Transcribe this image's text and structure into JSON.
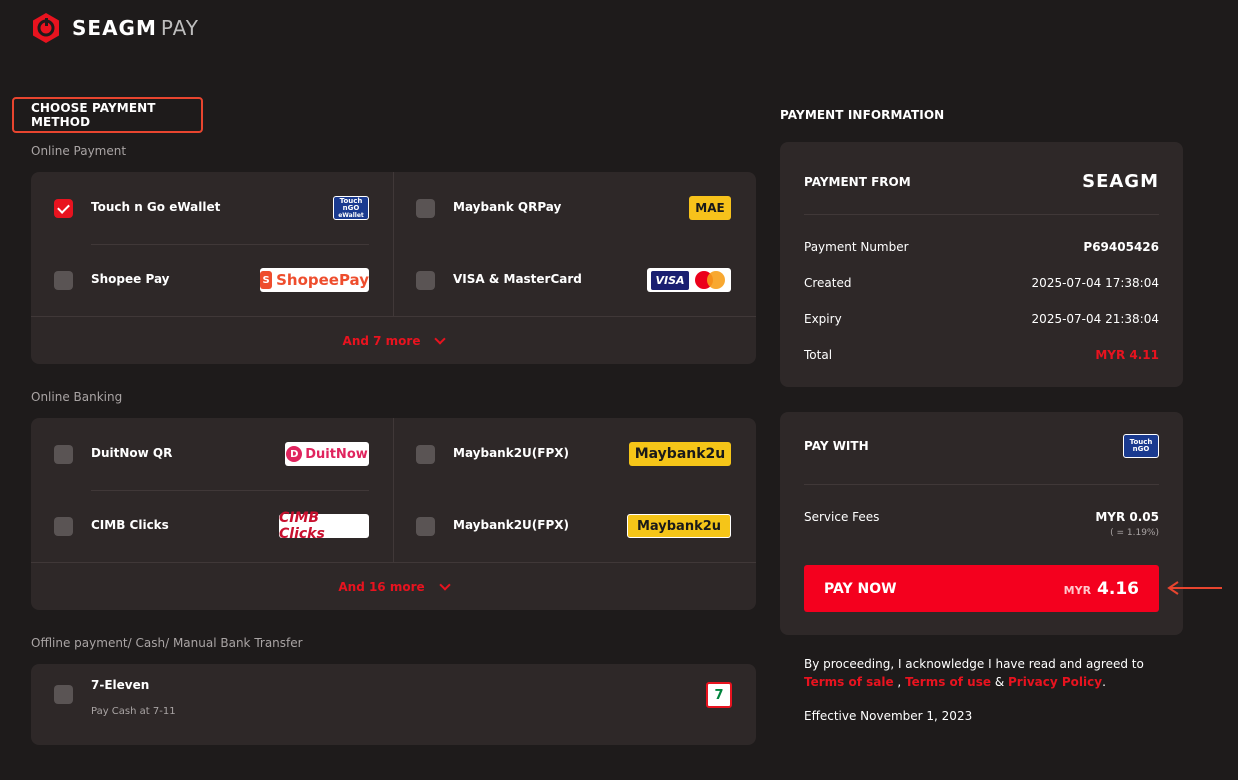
{
  "brand": {
    "name": "SEAGM",
    "suffix": "PAY"
  },
  "choose": {
    "title": "CHOOSE PAYMENT METHOD",
    "groups": [
      {
        "label": "Online Payment",
        "items": [
          {
            "name": "Touch n Go eWallet",
            "checked": true,
            "logo": "touchngo-ewallet-logo",
            "logo_text": "Touch n GO eWallet"
          },
          {
            "name": "Maybank QRPay",
            "checked": false,
            "logo": "mae-logo",
            "logo_text": "MAE"
          },
          {
            "name": "Shopee Pay",
            "checked": false,
            "logo": "shopeepay-logo",
            "logo_text": "ShopeePay"
          },
          {
            "name": "VISA & MasterCard",
            "checked": false,
            "logo": "visa-mastercard-logo",
            "logo_text": "VISA"
          }
        ],
        "more": "And 7 more"
      },
      {
        "label": "Online Banking",
        "items": [
          {
            "name": "DuitNow QR",
            "checked": false,
            "logo": "duitnow-logo",
            "logo_text": "DuitNow"
          },
          {
            "name": "Maybank2U(FPX)",
            "checked": false,
            "logo": "maybank2u-logo",
            "logo_text": "Maybank2u"
          },
          {
            "name": "CIMB Clicks",
            "checked": false,
            "logo": "cimb-clicks-logo",
            "logo_text": "CIMB Clicks"
          },
          {
            "name": "Maybank2U(FPX)",
            "checked": false,
            "logo": "maybank2u-logo",
            "logo_text": "Maybank2u"
          }
        ],
        "more": "And 16 more"
      },
      {
        "label": "Offline payment/ Cash/ Manual Bank Transfer",
        "items": [
          {
            "name": "7-Eleven",
            "sub": "Pay Cash at 7-11",
            "checked": false,
            "logo": "seven-eleven-logo",
            "logo_text": "7"
          }
        ]
      }
    ]
  },
  "info": {
    "title": "PAYMENT INFORMATION",
    "from_label": "PAYMENT FROM",
    "from_brand": "SEAGM",
    "payment_number_label": "Payment Number",
    "payment_number": "P69405426",
    "created_label": "Created",
    "created": "2025-07-04 17:38:04",
    "expiry_label": "Expiry",
    "expiry": "2025-07-04 21:38:04",
    "total_label": "Total",
    "total": "MYR 4.11"
  },
  "paywith": {
    "label": "PAY WITH",
    "fees_label": "Service Fees",
    "fees": "MYR 0.05",
    "fees_pct": "( = 1.19%)",
    "button_label": "PAY NOW",
    "button_currency": "MYR",
    "button_amount": "4.16"
  },
  "terms": {
    "text": "By proceeding, I acknowledge I have read and agreed to",
    "sale": "Terms of sale",
    "sep1": " , ",
    "use": "Terms of use",
    "sep2": " & ",
    "privacy": "Privacy Policy",
    "end": ".",
    "effective": "Effective November 1, 2023"
  },
  "colors": {
    "accent": "#e8131f",
    "background": "#1e1b1b",
    "card": "#2e2828"
  }
}
